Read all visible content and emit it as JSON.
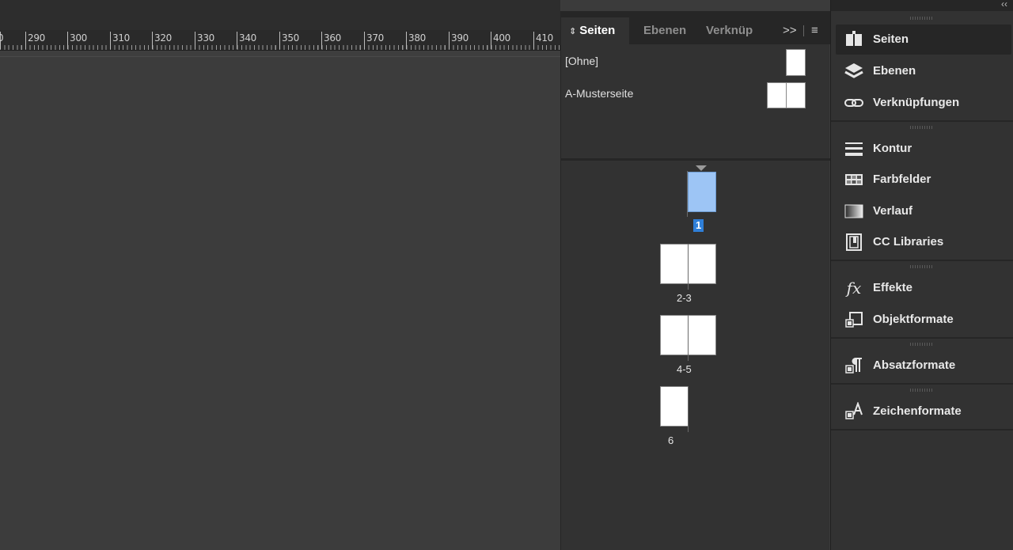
{
  "ruler": {
    "labels": [
      "0",
      "290",
      "300",
      "310",
      "320",
      "330",
      "340",
      "350",
      "360",
      "370",
      "380",
      "390",
      "400",
      "410"
    ]
  },
  "pages_panel": {
    "tabs": [
      "Seiten",
      "Ebenen",
      "Verknüp"
    ],
    "overflow_icon": ">>",
    "menu_icon": "menu-icon",
    "masters": [
      {
        "name": "[Ohne]"
      },
      {
        "name": "A-Musterseite"
      }
    ],
    "pages": [
      {
        "label": "1",
        "selected": true
      },
      {
        "label": "2-3",
        "selected": false
      },
      {
        "label": "4-5",
        "selected": false
      },
      {
        "label": "6",
        "selected": false
      }
    ]
  },
  "dock": {
    "collapse_icon": "‹‹",
    "items": [
      {
        "label": "Seiten",
        "icon": "pages-icon",
        "active": true
      },
      {
        "label": "Ebenen",
        "icon": "layers-icon",
        "active": false
      },
      {
        "label": "Verknüpfungen",
        "icon": "links-icon",
        "active": false
      },
      {
        "label": "Kontur",
        "icon": "stroke-icon",
        "active": false
      },
      {
        "label": "Farbfelder",
        "icon": "swatches-icon",
        "active": false
      },
      {
        "label": "Verlauf",
        "icon": "gradient-icon",
        "active": false
      },
      {
        "label": "CC Libraries",
        "icon": "cc-libraries-icon",
        "active": false
      },
      {
        "label": "Effekte",
        "icon": "effects-icon",
        "active": false
      },
      {
        "label": "Objektformate",
        "icon": "object-styles-icon",
        "active": false
      },
      {
        "label": "Absatzformate",
        "icon": "paragraph-styles-icon",
        "active": false
      },
      {
        "label": "Zeichenformate",
        "icon": "character-styles-icon",
        "active": false
      }
    ]
  },
  "colors": {
    "selection": "#2f7fd8",
    "selected_page_fill": "#9dc5f5",
    "panel_bg": "#323232",
    "pasteboard": "#3c3c3c"
  }
}
